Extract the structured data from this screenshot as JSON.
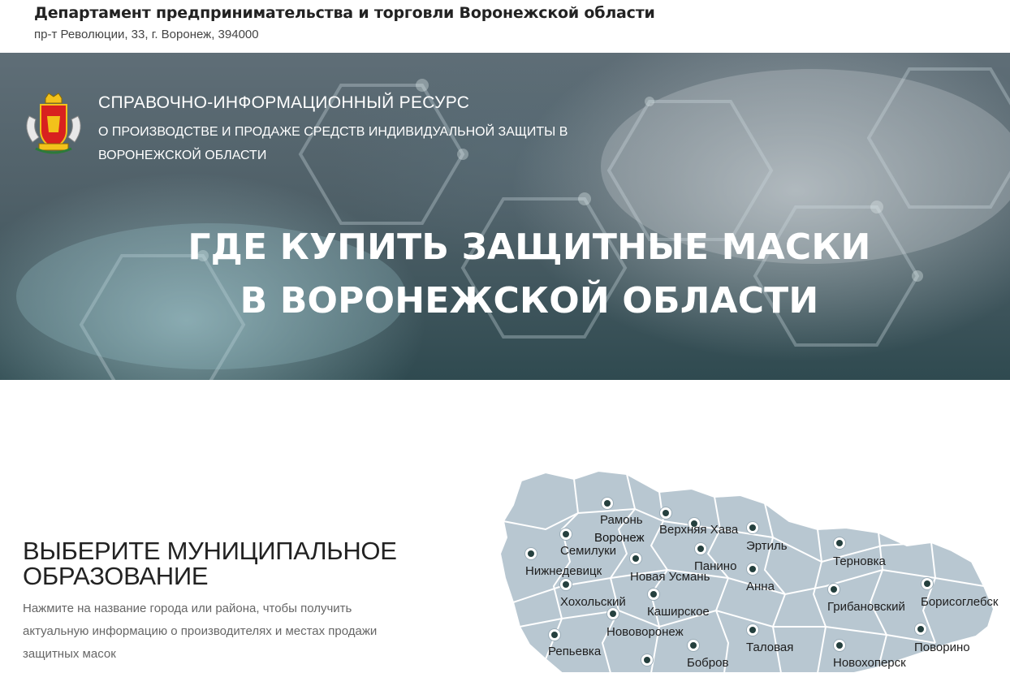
{
  "header": {
    "title": "Департамент предпринимательства и торговли Воронежской области",
    "address": "пр-т Революции, 33, г. Воронеж, 394000"
  },
  "hero": {
    "resource_title": "СПРАВОЧНО-ИНФОРМАЦИОННЫЙ РЕСУРС",
    "resource_subtitle": "О ПРОИЗВОДСТВЕ И ПРОДАЖЕ СРЕДСТВ ИНДИВИДУАЛЬНОЙ ЗАЩИТЫ В ВОРОНЕЖСКОЙ ОБЛАСТИ",
    "heading_line1": "ГДЕ КУПИТЬ ЗАЩИТНЫЕ МАСКИ",
    "heading_line2": "В ВОРОНЕЖСКОЙ ОБЛАСТИ",
    "emblem_icon": "coat-of-arms-icon"
  },
  "selector": {
    "title_line1": "ВЫБЕРИТЕ МУНИЦИПАЛЬНОЕ",
    "title_line2": "ОБРАЗОВАНИЕ",
    "hint": "Нажмите на название города или района, чтобы получить актуальную информацию о производителях и местах продажи защитных масок"
  },
  "map": {
    "fill_color": "#b8c7d1",
    "border_color": "#ffffff",
    "marker_color": "#25403e",
    "places": [
      "Рамонь",
      "Воронеж",
      "Верхняя Хава",
      "Эртиль",
      "Терновка",
      "Семилуки",
      "Панино",
      "Нижнедевицк",
      "Новая Усмань",
      "Анна",
      "Борисоглебск",
      "Хохольский",
      "Каширское",
      "Грибановский",
      "Нововоронеж",
      "Поворино",
      "Репьевка",
      "Таловая",
      "Бобров",
      "Новохоперск"
    ]
  }
}
